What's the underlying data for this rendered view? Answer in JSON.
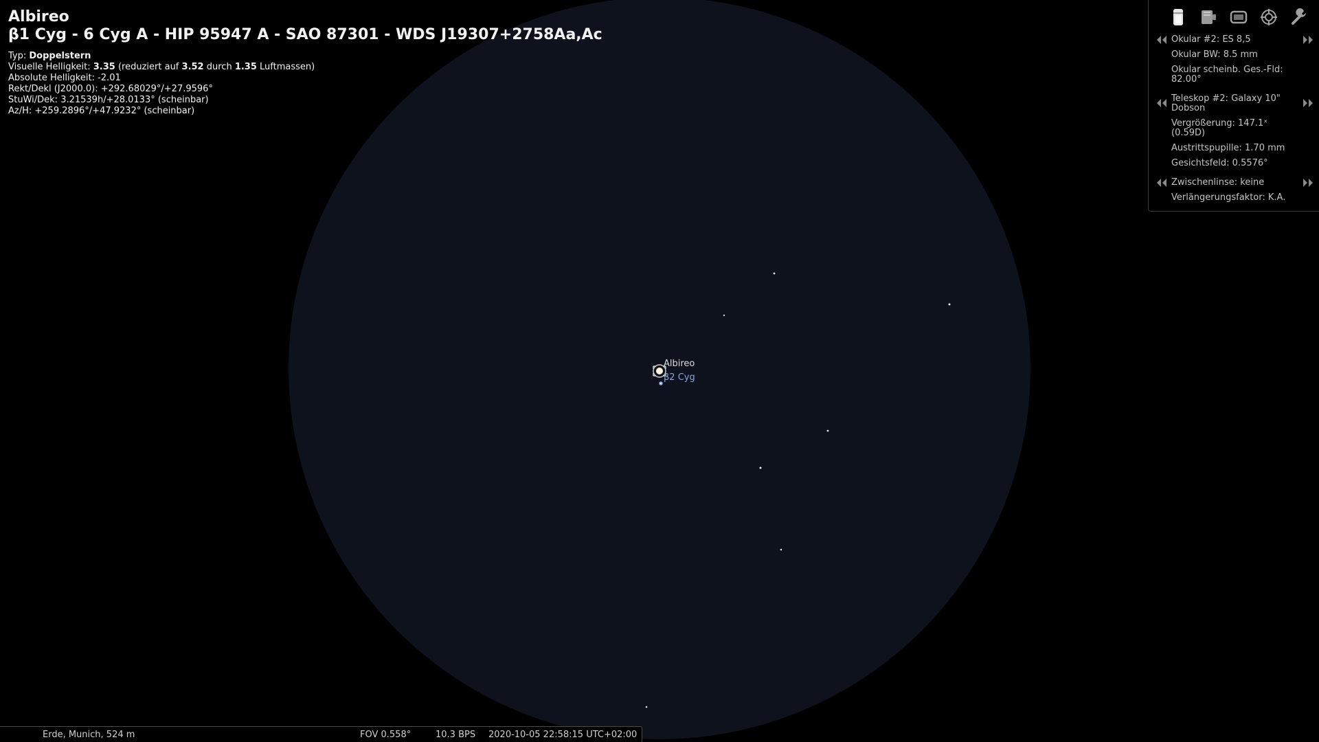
{
  "object": {
    "name": "Albireo",
    "designations": "β1 Cyg - 6 Cyg A - HIP 95947 A - SAO 87301 - WDS J19307+2758Aa,Ac",
    "type_label": "Typ:",
    "type_value": "Doppelstern",
    "vmag_label": "Visuelle Helligkeit:",
    "vmag_value": "3.35",
    "vmag_reduced_pre": "(reduziert auf",
    "vmag_reduced_value": "3.52",
    "vmag_airmass_pre": "durch",
    "vmag_airmass_value": "1.35",
    "vmag_airmass_post": "Luftmassen)",
    "absmag": "Absolute Helligkeit: -2.01",
    "radec_j2000": "Rekt/Dekl (J2000.0): +292.68029°/+27.9596°",
    "hadec": "StuWi/Dek: 3.21539h/+28.0133° (scheinbar)",
    "azalt": "Az/H: +259.2896°/+47.9232° (scheinbar)"
  },
  "sky_labels": {
    "primary": "Albireo",
    "secondary": "β2 Cyg"
  },
  "colors": {
    "fov_background": "#0e121d",
    "primary_label": "#dcdcdc",
    "secondary_label": "#8aa4d8",
    "panel_text": "#c4c4c4"
  },
  "oculars_panel": {
    "toolbar": [
      {
        "icon": "eyepiece-icon"
      },
      {
        "icon": "telrad-icon"
      },
      {
        "icon": "ccd-icon"
      },
      {
        "icon": "finder-icon"
      },
      {
        "icon": "wrench-icon"
      }
    ],
    "eyepiece": {
      "name": "Okular #2: ES 8,5",
      "focal_length": "Okular BW: 8.5 mm",
      "afov": "Okular scheinb. Ges.-Fld: 82.00°"
    },
    "telescope": {
      "name": "Teleskop #2: Galaxy 10\" Dobson",
      "magnification": "Vergrößerung: 147.1ˣ (0.59D)",
      "exit_pupil": "Austrittspupille: 1.70 mm",
      "fov": "Gesichtsfeld: 0.5576°"
    },
    "lens": {
      "name": "Zwischenlinse: keine",
      "factor": "Verlängerungsfaktor: K.A."
    }
  },
  "status_bar": {
    "location": "Erde, Munich, 524 m",
    "fov": "FOV 0.558°",
    "fps": "10.3 BPS",
    "datetime": "2020-10-05 22:58:15 UTC+02:00"
  }
}
